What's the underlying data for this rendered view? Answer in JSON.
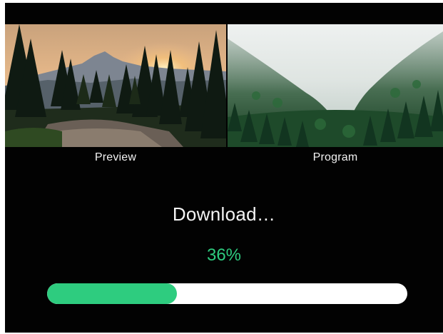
{
  "monitors": {
    "preview_label": "Preview",
    "program_label": "Program"
  },
  "download": {
    "status_text": "Download…",
    "progress_text": "36%",
    "progress_fraction": 0.36
  },
  "colors": {
    "accent": "#2ecc7f",
    "background": "#020202",
    "track": "#ffffff",
    "text": "#f5f5f5"
  }
}
